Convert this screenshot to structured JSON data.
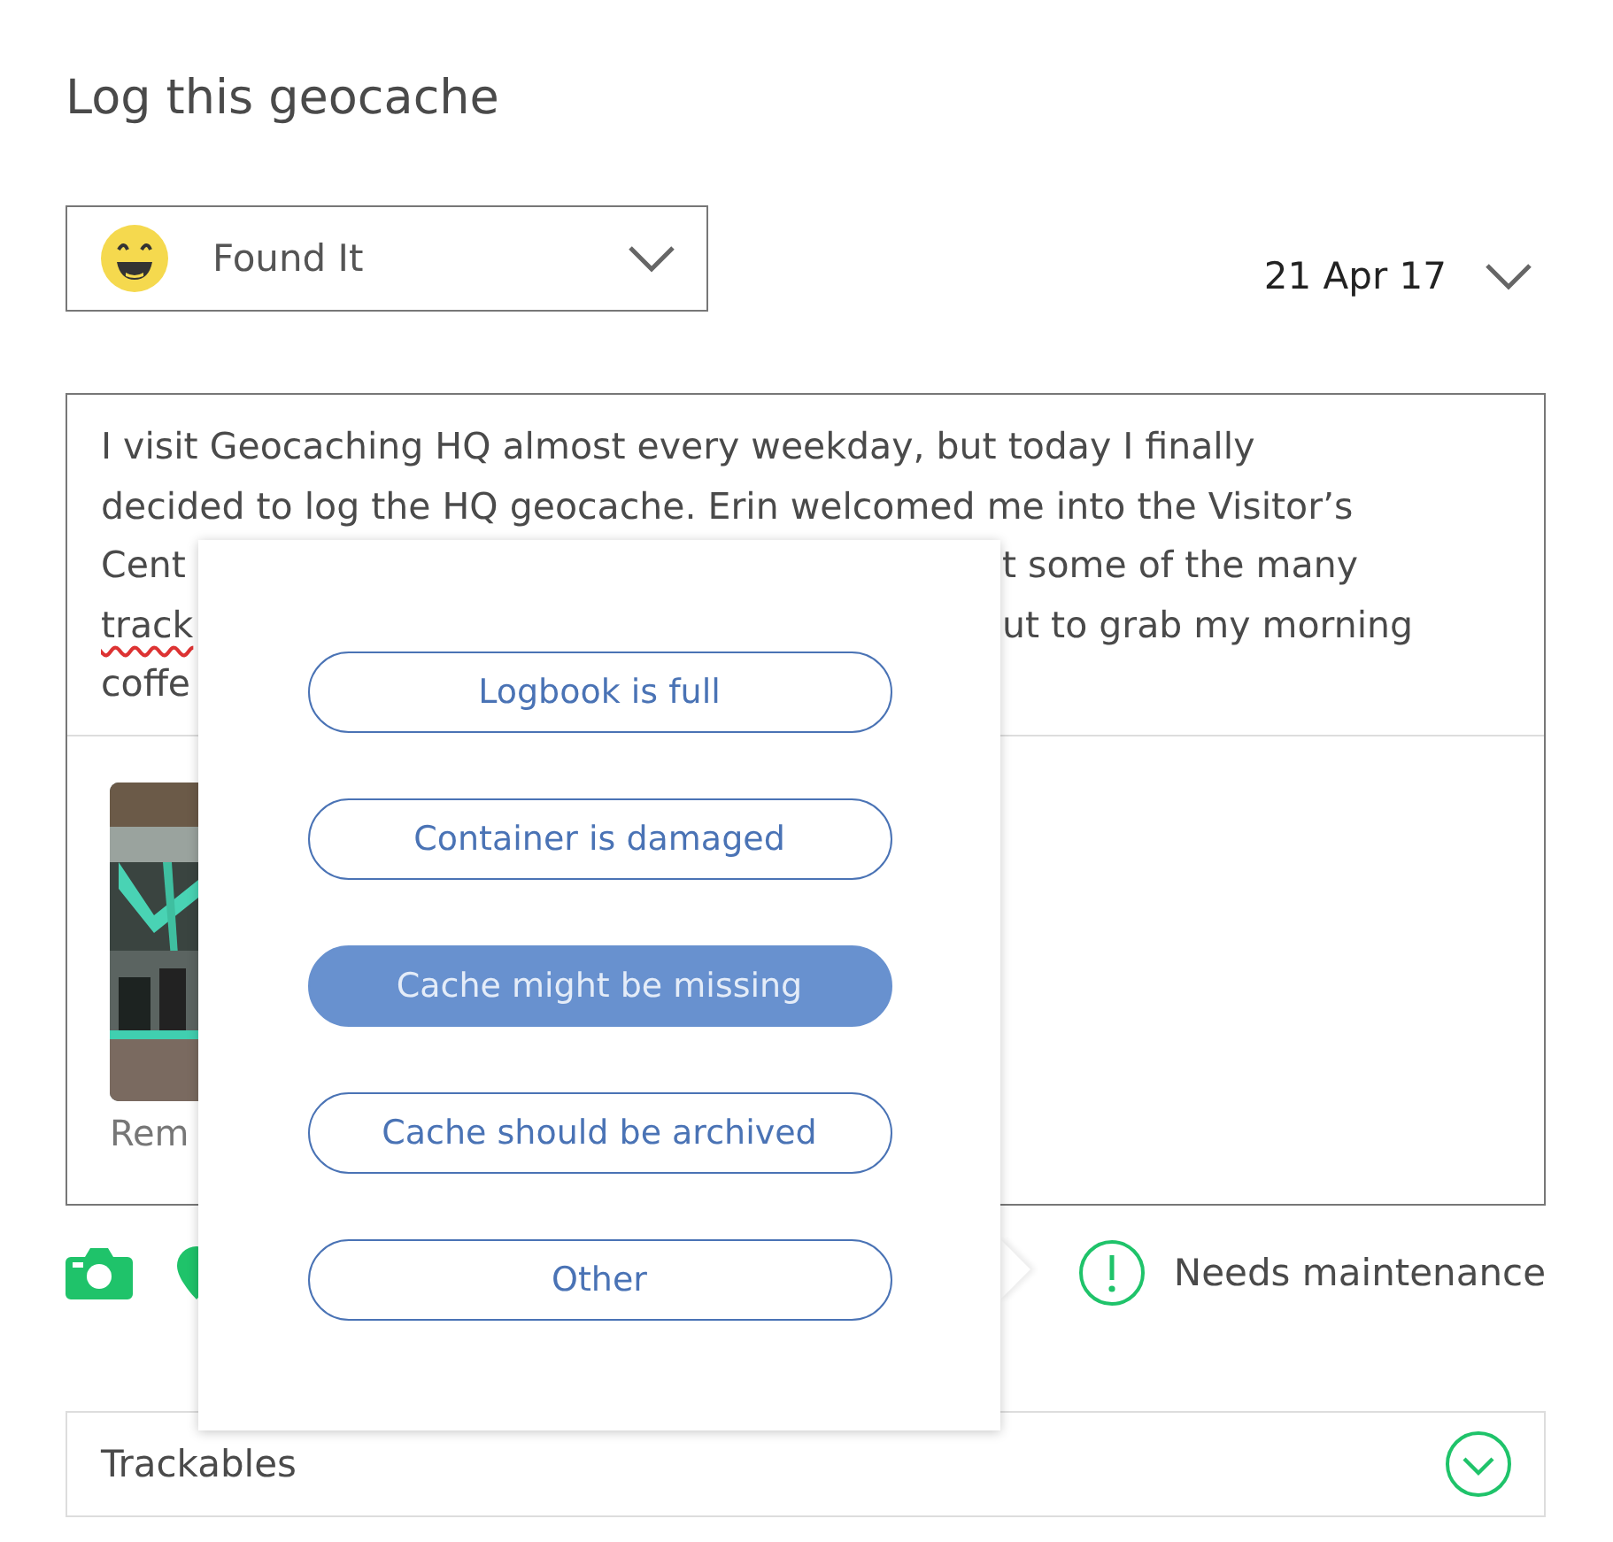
{
  "title": "Log this geocache",
  "log_type": {
    "label": "Found It"
  },
  "date": {
    "label": "21 Apr 17"
  },
  "log_text": {
    "lines": [
      [
        {
          "text": "I visit Geocaching HQ almost every weekday, but today I finally",
          "misspelled": false
        }
      ],
      [
        {
          "text": "decided to log the HQ geocache. Erin welcomed me into the Visitor’s",
          "misspelled": false
        }
      ],
      [
        {
          "text": "Cent",
          "misspelled": false
        },
        {
          "text": "t some of the many",
          "misspelled": false
        }
      ],
      [
        {
          "text": "track",
          "misspelled": true
        },
        {
          "text": "ut to grab my morning",
          "misspelled": false
        }
      ],
      [
        {
          "text": "coffe",
          "misspelled": false
        }
      ]
    ]
  },
  "photos": [
    {
      "kind": "picture",
      "caption": "Rem"
    }
  ],
  "needs_maintenance": {
    "label": "Needs maintenance"
  },
  "maintenance_options": [
    {
      "label": "Logbook is full",
      "selected": false
    },
    {
      "label": "Container is damaged",
      "selected": false
    },
    {
      "label": "Cache might be missing",
      "selected": true
    },
    {
      "label": "Cache should be archived",
      "selected": false
    },
    {
      "label": "Other",
      "selected": false
    }
  ],
  "trackables": {
    "label": "Trackables"
  }
}
